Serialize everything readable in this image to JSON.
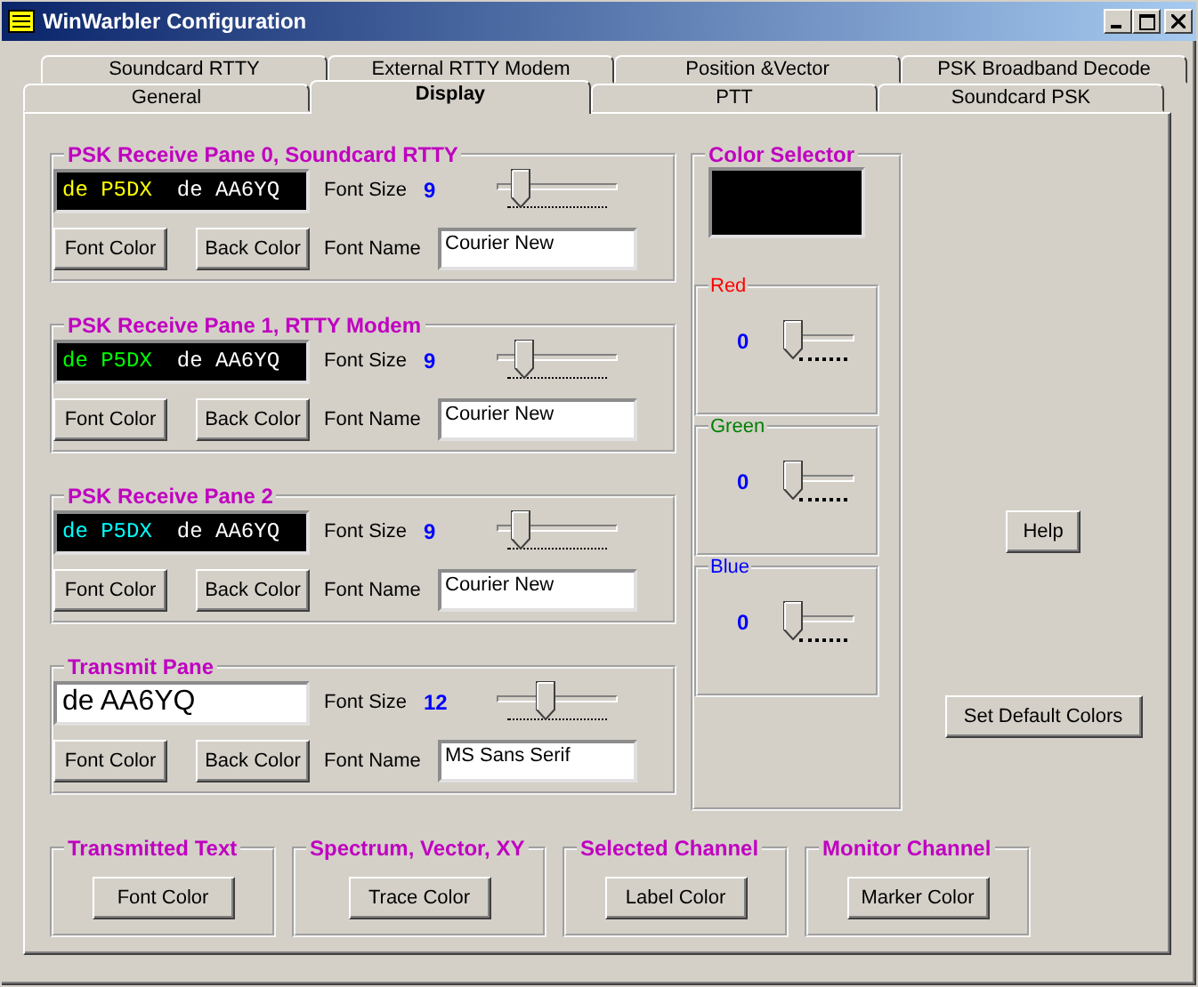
{
  "window": {
    "title": "WinWarbler Configuration"
  },
  "tabs": [
    [
      {
        "label": "Soundcard RTTY",
        "selected": false
      },
      {
        "label": "External RTTY Modem",
        "selected": false
      },
      {
        "label": "Position &Vector",
        "selected": false
      },
      {
        "label": "PSK Broadband Decode",
        "selected": false
      }
    ],
    [
      {
        "label": "General",
        "selected": false
      },
      {
        "label": "Display",
        "selected": true
      },
      {
        "label": "PTT",
        "selected": false
      },
      {
        "label": "Soundcard PSK",
        "selected": false
      }
    ]
  ],
  "panes": [
    {
      "title": "PSK Receive Pane 0, Soundcard RTTY",
      "kind": "receive",
      "color": "#ffff00",
      "preview": [
        "de P5DX",
        "de AA6YQ"
      ],
      "font_size_label": "Font Size",
      "font_size": "9",
      "level": 0.18,
      "font_color_button": "Font Color",
      "back_color_button": "Back Color",
      "font_name_label": "Font Name",
      "font_name": "Courier New"
    },
    {
      "title": "PSK Receive Pane 1, RTTY Modem",
      "kind": "receive",
      "color": "#00ff00",
      "preview": [
        "de P5DX",
        "de AA6YQ"
      ],
      "font_size_label": "Font Size",
      "font_size": "9",
      "level": 0.21,
      "font_color_button": "Font Color",
      "back_color_button": "Back Color",
      "font_name_label": "Font Name",
      "font_name": "Courier New"
    },
    {
      "title": "PSK Receive Pane 2",
      "kind": "receive",
      "color": "#00ffff",
      "preview": [
        "de P5DX",
        "de AA6YQ"
      ],
      "font_size_label": "Font Size",
      "font_size": "9",
      "level": 0.18,
      "font_color_button": "Font Color",
      "back_color_button": "Back Color",
      "font_name_label": "Font Name",
      "font_name": "Courier New"
    },
    {
      "title": "Transmit Pane",
      "kind": "transmit",
      "color": "#000000",
      "preview": [
        "de AA6YQ"
      ],
      "font_size_label": "Font Size",
      "font_size": "12",
      "level": 0.4,
      "font_color_button": "Font Color",
      "back_color_button": "Back Color",
      "font_name_label": "Font Name",
      "font_name": "MS Sans Serif"
    }
  ],
  "color_selector": {
    "title": "Color Selector",
    "channels": [
      {
        "name": "Red",
        "color": "#ff0000",
        "reading": "0",
        "level": 0
      },
      {
        "name": "Green",
        "color": "#008000",
        "reading": "0",
        "level": 0
      },
      {
        "name": "Blue",
        "color": "#0000ff",
        "reading": "0",
        "level": 0
      }
    ]
  },
  "buttons": {
    "help": "Help",
    "defaults": "Set Default Colors"
  },
  "groups": [
    {
      "title": "Transmitted Text",
      "button": "Font Color"
    },
    {
      "title": "Spectrum, Vector, XY",
      "button": "Trace Color"
    },
    {
      "title": "Selected Channel",
      "button": "Label Color"
    },
    {
      "title": "Monitor Channel",
      "button": "Marker Color"
    }
  ]
}
